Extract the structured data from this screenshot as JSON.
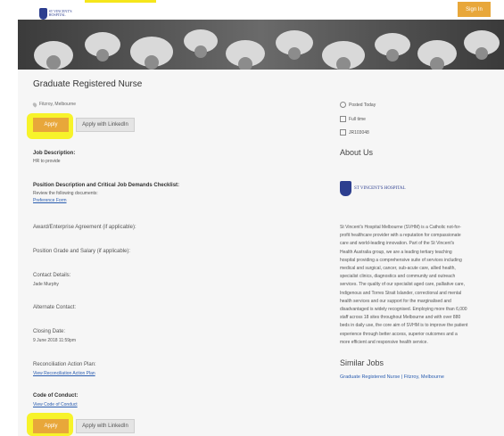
{
  "header": {
    "logo_text": "ST VINCENT'S HOSPITAL",
    "sign_in_label": "Sign In"
  },
  "job": {
    "title": "Graduate Registered Nurse",
    "location": "Fitzroy, Melbourne",
    "apply_label": "Apply",
    "linkedin_label": "Apply with LinkedIn"
  },
  "sections": {
    "job_description": {
      "title": "Job Description:",
      "text": "HR to provide"
    },
    "position_description": {
      "title": "Position Description and Critical Job Demands Checklist:",
      "text": "Review the following documents:",
      "link": "Preference Form"
    },
    "award": {
      "title": "Award/Enterprise Agreement (if applicable):"
    },
    "grade": {
      "title": "Position Grade and Salary (if applicable):"
    },
    "contact": {
      "title": "Contact Details:",
      "text": "Jade Murphy"
    },
    "alternate": {
      "title": "Alternate Contact:"
    },
    "closing": {
      "title": "Closing Date:",
      "text": "9 June 2018 11:59pm"
    },
    "reconciliation": {
      "title": "Reconciliation Action Plan:",
      "link": "View Reconciliation Action Plan"
    },
    "conduct": {
      "title": "Code of Conduct:",
      "link": "View Code of Conduct"
    }
  },
  "meta": {
    "posted": "Posted Today",
    "type": "Full time",
    "ref": "JR103048"
  },
  "about": {
    "heading": "About Us",
    "logo_text": "ST VINCENT'S HOSPITAL",
    "lines": [
      "St Vincent's Hospital Melbourne (SVHM) is a Catholic not-for-",
      "profit healthcare provider with a reputation for compassionate",
      "care and world-leading innovation. Part of the St Vincent's",
      "Health Australia group, we are a leading tertiary teaching",
      "hospital providing a comprehensive suite of services including",
      "medical and surgical, cancer, sub-acute care, allied health,",
      "specialist clinics, diagnostics and community and outreach",
      "services. The quality of our specialist aged care, palliative care,",
      "Indigenous and Torres Strait Islander, correctional and mental",
      "health services and our support for the marginalised and",
      "disadvantaged is widely recognised. Employing more than 6,000",
      "staff across 18 sites throughout Melbourne and with over 880",
      "beds in daily use, the core aim of SVHM is to improve the patient",
      "experience through better access, superior outcomes and a",
      "more efficient and responsive health service."
    ]
  },
  "similar": {
    "heading": "Similar Jobs",
    "link": "Graduate Registered Nurse | Fitzroy, Melbourne"
  }
}
